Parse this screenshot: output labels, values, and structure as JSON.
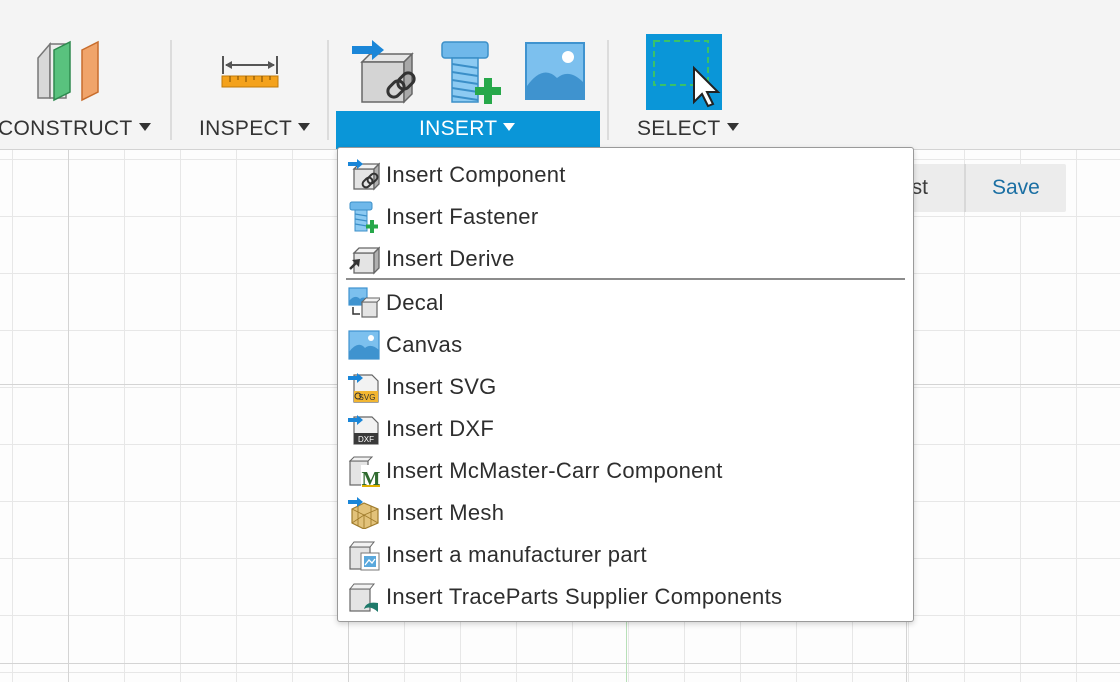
{
  "toolbar": {
    "groups": [
      {
        "label": "CONSTRUCT",
        "icon": "construct-plane-icon"
      },
      {
        "label": "INSPECT",
        "icon": "measure-icon"
      },
      {
        "label": "INSERT",
        "icon": "insert-icon",
        "active": true
      },
      {
        "label": "SELECT",
        "icon": "select-icon"
      }
    ],
    "insert_icons": [
      "insert-component-icon",
      "insert-fastener-icon",
      "canvas-icon"
    ]
  },
  "status_bar": {
    "post_fragment": "ost",
    "save_label": "Save"
  },
  "insert_menu": {
    "items": [
      {
        "label": "Insert Component",
        "icon": "insert-component-icon"
      },
      {
        "label": "Insert Fastener",
        "icon": "insert-fastener-icon"
      },
      {
        "label": "Insert Derive",
        "icon": "insert-derive-icon"
      },
      {
        "label": "Decal",
        "icon": "decal-icon"
      },
      {
        "label": "Canvas",
        "icon": "canvas-icon"
      },
      {
        "label": "Insert SVG",
        "icon": "insert-svg-icon"
      },
      {
        "label": "Insert DXF",
        "icon": "insert-dxf-icon"
      },
      {
        "label": "Insert McMaster-Carr Component",
        "icon": "mcmaster-carr-icon"
      },
      {
        "label": "Insert Mesh",
        "icon": "insert-mesh-icon"
      },
      {
        "label": "Insert a manufacturer part",
        "icon": "manufacturer-part-icon"
      },
      {
        "label": "Insert TraceParts Supplier Components",
        "icon": "traceparts-icon"
      }
    ],
    "icon_badges": {
      "svg": "SVG",
      "dxf": "DXF",
      "mcmaster": "M"
    }
  },
  "colors": {
    "accent": "#0a96d8",
    "toolbar_bg": "#f4f4f4",
    "save_text": "#1a6fa3"
  }
}
